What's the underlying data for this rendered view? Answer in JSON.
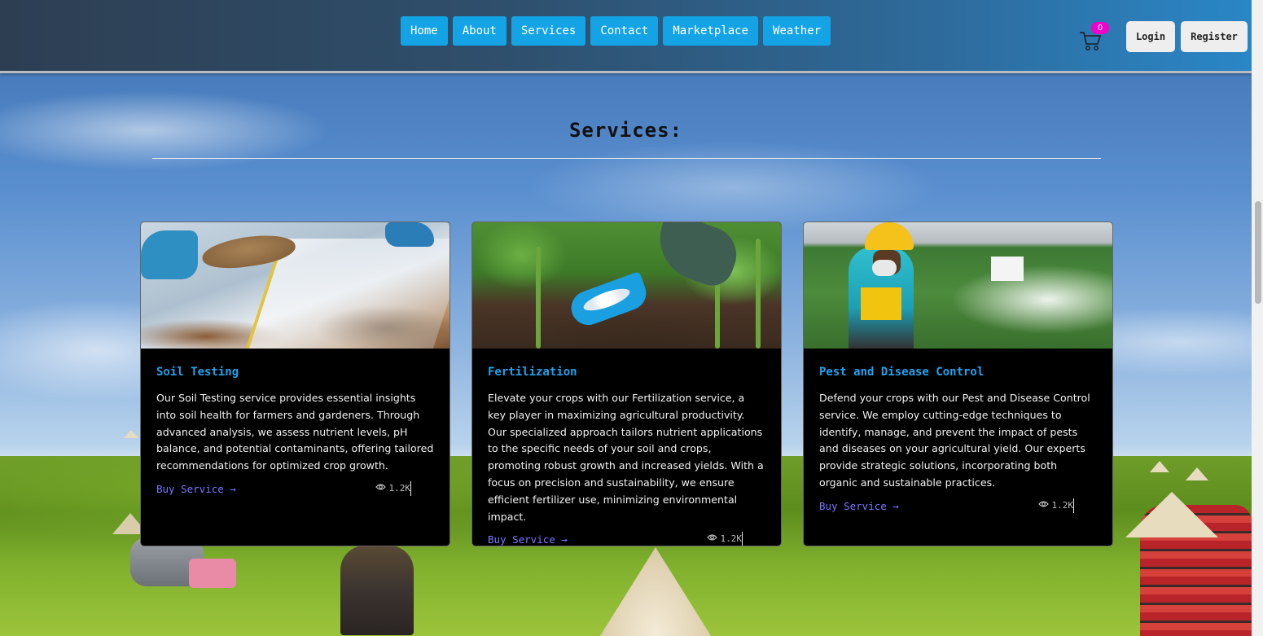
{
  "nav": {
    "items": [
      {
        "label": "Home"
      },
      {
        "label": "About"
      },
      {
        "label": "Services"
      },
      {
        "label": "Contact"
      },
      {
        "label": "Marketplace"
      },
      {
        "label": "Weather"
      }
    ]
  },
  "cart": {
    "icon": "cart-icon",
    "count": "0",
    "badge_color": "#f000c8"
  },
  "auth": {
    "login_label": "Login",
    "register_label": "Register"
  },
  "section": {
    "title": "Services:"
  },
  "cards": [
    {
      "title": "Soil Testing",
      "description": "Our Soil Testing service provides essential insights into soil health for farmers and gardeners. Through advanced analysis, we assess nutrient levels, pH balance, and potential contaminants, offering tailored recommendations for optimized crop growth.",
      "link_label": "Buy Service →",
      "views": "1.2K"
    },
    {
      "title": "Fertilization",
      "description": "Elevate your crops with our Fertilization service, a key player in maximizing agricultural productivity. Our specialized approach tailors nutrient applications to the specific needs of your soil and crops, promoting robust growth and increased yields. With a focus on precision and sustainability, we ensure efficient fertilizer use, minimizing environmental impact.",
      "link_label": "Buy Service →",
      "views": "1.2K"
    },
    {
      "title": "Pest and Disease Control",
      "description": "Defend your crops with our Pest and Disease Control service. We employ cutting-edge techniques to identify, manage, and prevent the impact of pests and diseases on your agricultural yield. Our experts provide strategic solutions, incorporating both organic and sustainable practices.",
      "link_label": "Buy Service →",
      "views": "1.2K"
    }
  ],
  "colors": {
    "nav_button": "#14a4e6",
    "card_title": "#1ea3f0",
    "buy_link": "#7b78ff",
    "card_bg": "#000000"
  }
}
